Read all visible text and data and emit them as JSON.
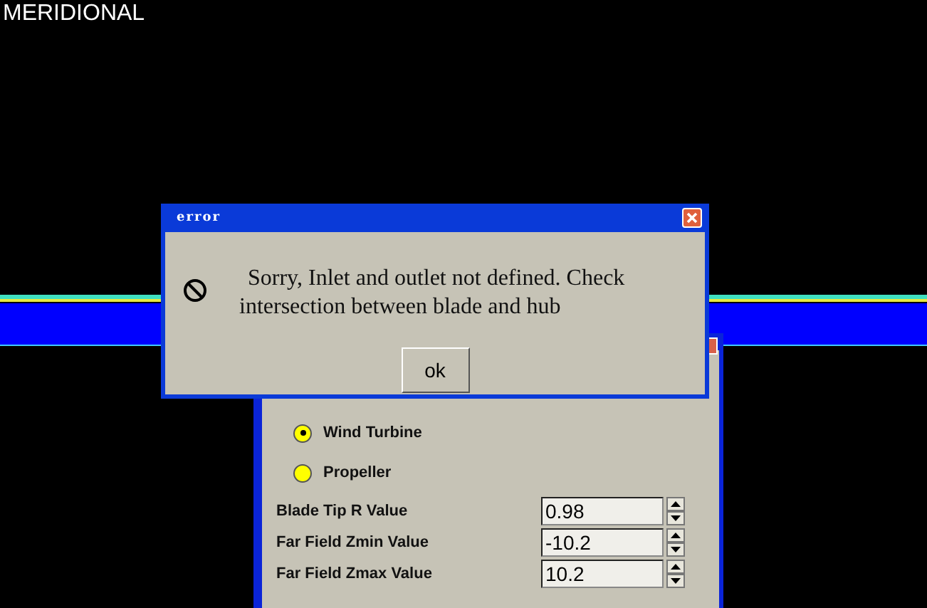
{
  "view": {
    "title": "MERIDIONAL"
  },
  "panel": {
    "options": [
      {
        "label": "Wind Turbine",
        "selected": true
      },
      {
        "label": "Propeller",
        "selected": false
      }
    ],
    "fields": [
      {
        "label": "Blade Tip R Value",
        "value": "0.98"
      },
      {
        "label": "Far Field Zmin Value",
        "value": "-10.2"
      },
      {
        "label": "Far Field Zmax Value",
        "value": "10.2"
      }
    ]
  },
  "dialog": {
    "title": "error",
    "message": "Sorry, Inlet and outlet not defined. Check intersection between blade and hub",
    "button": "ok"
  }
}
